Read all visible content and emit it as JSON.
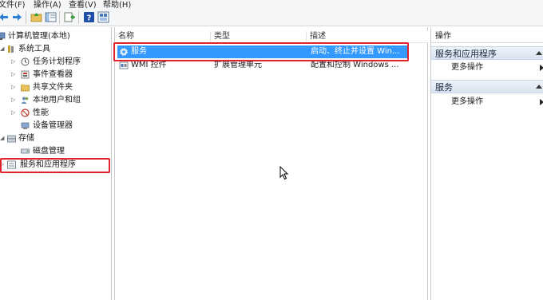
{
  "menubar": {
    "items": [
      "文件(F)",
      "操作(A)",
      "查看(V)",
      "帮助(H)"
    ]
  },
  "toolbar": {
    "icons": [
      "back-icon",
      "forward-icon",
      "up-folder-icon",
      "show-hide-tree-icon",
      "export-list-icon",
      "help-icon",
      "properties-icon"
    ]
  },
  "tree": {
    "root": "计算机管理(本地)",
    "system_tools": "系统工具",
    "task_scheduler": "任务计划程序",
    "event_viewer": "事件查看器",
    "shared_folders": "共享文件夹",
    "local_users": "本地用户和组",
    "performance": "性能",
    "device_manager": "设备管理器",
    "storage": "存储",
    "disk_management": "磁盘管理",
    "services_apps": "服务和应用程序"
  },
  "list": {
    "columns": [
      "名称",
      "类型",
      "描述"
    ],
    "rows": [
      {
        "name": "服务",
        "type": "",
        "description": "启动、终止并设置 Win...",
        "selected": true
      },
      {
        "name": "WMI 控件",
        "type": "扩展管理单元",
        "description": "配置和控制 Windows ...",
        "selected": false
      }
    ]
  },
  "actions": {
    "title": "操作",
    "section1": "服务和应用程序",
    "section1_item": "更多操作",
    "section2": "服务",
    "section2_item": "更多操作"
  },
  "colors": {
    "selection": "#3399ff",
    "highlight_box": "#e0232d",
    "action_header": "#d9e4f1"
  }
}
